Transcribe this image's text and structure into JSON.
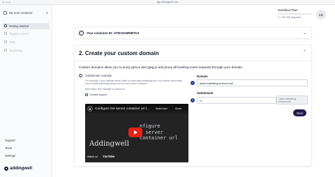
{
  "browser": {
    "url": "app.addingwell.com"
  },
  "sidebar": {
    "container": "My new container",
    "nav": [
      {
        "label": "Getting Started",
        "active": true
      },
      {
        "label": "Tagging Server",
        "active": false
      },
      {
        "label": "Data",
        "active": false
      },
      {
        "label": "Monitoring",
        "active": false
      }
    ],
    "footer": [
      "Support",
      "Team",
      "Settings"
    ],
    "logo": "addingwell"
  },
  "header": {
    "plan_name": "Sandbox Plan",
    "usage_fraction": 0,
    "usage_text": "0 / 100 000 requests",
    "avatar_initials": "LK"
  },
  "step1": {
    "title": "Your container ID: GTM-NGMNBTKZ"
  },
  "step2": {
    "title": "2. Create your custom domain",
    "description": "Custom domains allow you to proxy gtm.js and gtag.js and proxy all tracking event requests through your domain.",
    "subdomain_example": {
      "title": "Subdomain example",
      "body": "For example, if your website server traffic on www.data-marketing.com, use another subdomain such as data-marketing-school.com for your server container.",
      "help": "Need help? don't hesitate to contact us",
      "support_link": "Contact support"
    },
    "video": {
      "channel_initial": "A",
      "title": "Configure the server container url f...",
      "watch_later": "Watch later",
      "share": "Share",
      "overlay_line1": "nfigure",
      "overlay_line2": "e server container url",
      "brand": "Addingwell",
      "watch_on": "Watch on",
      "yt": "YouTube"
    },
    "form": {
      "domain_label": "Domain",
      "domain_value": "data-marketing-school.com",
      "subdomain_label": "Subdomain",
      "subdomain_placeholder": "tkr",
      "subdomain_suffix": ".data-marketing-school.com",
      "next_button": "Next"
    }
  }
}
